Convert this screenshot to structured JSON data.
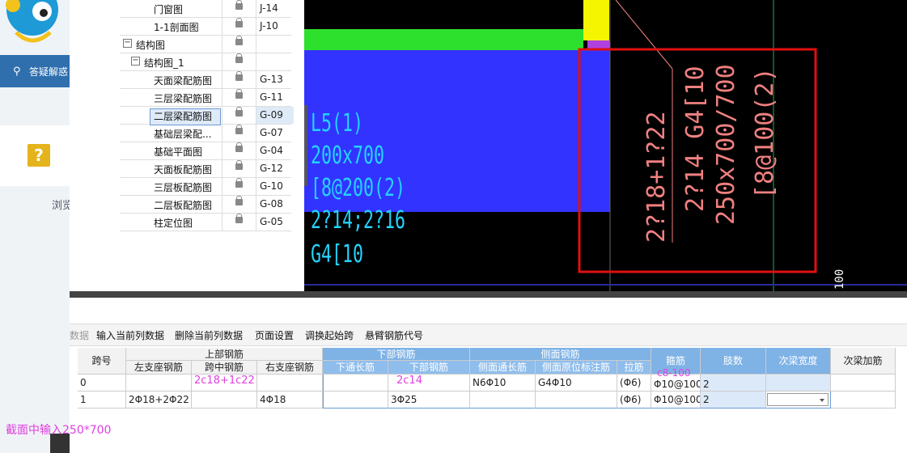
{
  "bg_app": {
    "nav_label": "答疑解惑",
    "browse_text": "浏览"
  },
  "tree": {
    "rows": [
      {
        "name": "门窗图",
        "code": "J-14",
        "level": 2
      },
      {
        "name": "1-1剖面图",
        "code": "J-10",
        "level": 2
      },
      {
        "name": "结构图",
        "code": "",
        "level": 0,
        "expander": "−"
      },
      {
        "name": "结构图_1",
        "code": "",
        "level": 1,
        "expander": "−"
      },
      {
        "name": "天面梁配筋图",
        "code": "G-13",
        "level": 2
      },
      {
        "name": "三层梁配筋图",
        "code": "G-11",
        "level": 2
      },
      {
        "name": "二层梁配筋图",
        "code": "G-09",
        "level": 2,
        "selected": true
      },
      {
        "name": "基础层梁配...",
        "code": "G-07",
        "level": 2
      },
      {
        "name": "基础平面图",
        "code": "G-04",
        "level": 2
      },
      {
        "name": "天面板配筋图",
        "code": "G-12",
        "level": 2
      },
      {
        "name": "三层板配筋图",
        "code": "G-10",
        "level": 2
      },
      {
        "name": "二层板配筋图",
        "code": "G-08",
        "level": 2
      },
      {
        "name": "柱定位图",
        "code": "G-05",
        "level": 2
      }
    ]
  },
  "cad": {
    "left_labels": [
      "L5(1)",
      "200x700",
      "[8@200(2)",
      "2?14;2?16",
      "G4[10"
    ],
    "right_labels": [
      "2?18+1?22",
      "2?14 G4[10",
      "250x700/700",
      "[8@100(2)"
    ],
    "dim_label": "100",
    "colors": {
      "green": "#2ee02e",
      "blue": "#3333ff",
      "yellow": "#f5f500",
      "cyan": "#22d4ff",
      "pink": "#f08080",
      "red": "#e01010"
    }
  },
  "toolbar": {
    "items": [
      "数据",
      "输入当前列数据",
      "删除当前列数据",
      "页面设置",
      "调换起始跨",
      "悬臂钢筋代号"
    ]
  },
  "grid": {
    "group_headers": {
      "top": "上部钢筋",
      "bottom": "下部钢筋",
      "side": "侧面钢筋"
    },
    "headers": {
      "span": "跨号",
      "left_support": "左支座钢筋",
      "mid": "跨中钢筋",
      "right_support": "右支座钢筋",
      "bottom_through": "下通长筋",
      "bottom_bar": "下部钢筋",
      "side_through": "侧面通长筋",
      "side_original": "侧面原位标注筋",
      "tie": "拉筋",
      "stirrup": "箍筋",
      "legs": "肢数",
      "sec_width": "次梁宽度",
      "sec_rebar": "次梁加筋"
    },
    "rows": [
      {
        "span": "0",
        "left": "",
        "mid": "2c18+1c22",
        "right": "",
        "bthrough": "",
        "bbar": "2c14",
        "sthrough": "N6Φ10",
        "sorig": "G4Φ10",
        "tie": "(Φ6)",
        "stirrup": "Φ10@100",
        "legs": "2",
        "swidth": "",
        "srebar": ""
      },
      {
        "span": "1",
        "left": "2Φ18+2Φ22",
        "mid": "",
        "right": "4Φ18",
        "bthrough": "",
        "bbar": "3Φ25",
        "sthrough": "",
        "sorig": "",
        "tie": "(Φ6)",
        "stirrup": "Φ10@100",
        "legs": "2",
        "swidth": "",
        "srebar": ""
      }
    ],
    "stirrup_note": "c8-100"
  },
  "annotation": "截面中输入250*700"
}
